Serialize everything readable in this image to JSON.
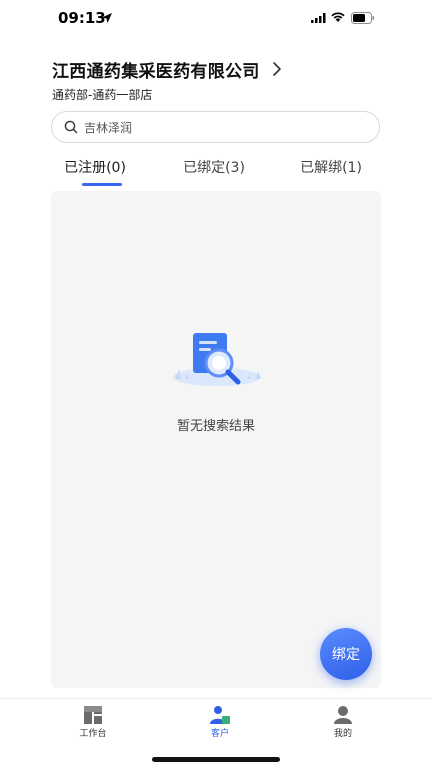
{
  "status_bar": {
    "time": "09:13"
  },
  "header": {
    "company_name": "江西通药集采医药有限公司",
    "subtitle": "通药部-通药一部店"
  },
  "search": {
    "value": "吉林泽润"
  },
  "tabs": [
    {
      "label": "已注册(0)",
      "active": true
    },
    {
      "label": "已绑定(3)",
      "active": false
    },
    {
      "label": "已解绑(1)",
      "active": false
    }
  ],
  "empty_state": {
    "message": "暂无搜索结果"
  },
  "fab": {
    "label": "绑定"
  },
  "bottom_nav": [
    {
      "label": "工作台",
      "icon": "dashboard-icon",
      "active": false
    },
    {
      "label": "客户",
      "icon": "customers-icon",
      "active": true
    },
    {
      "label": "我的",
      "icon": "profile-icon",
      "active": false
    }
  ],
  "colors": {
    "accent": "#3a66f0",
    "panel_bg": "#f5f5f6"
  }
}
